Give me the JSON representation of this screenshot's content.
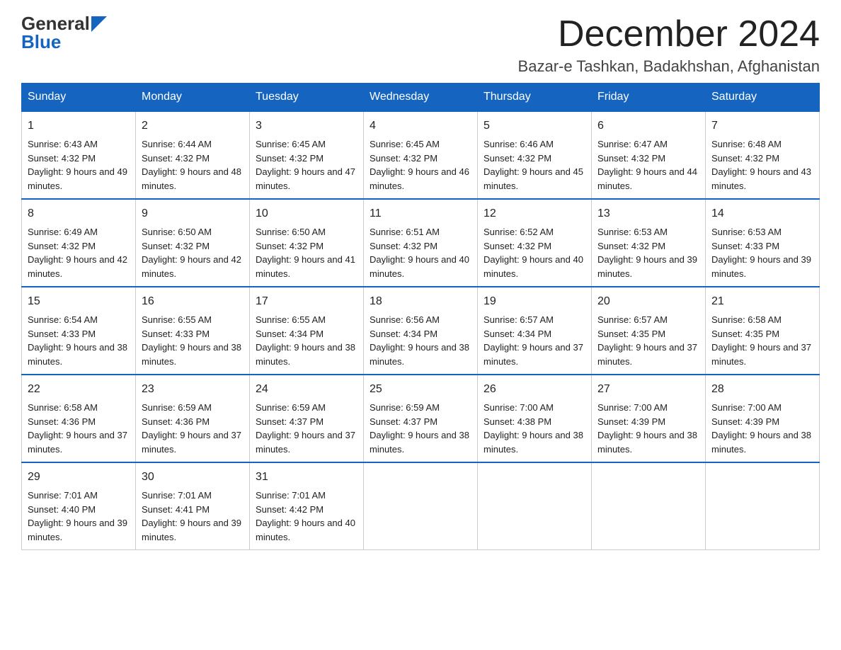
{
  "header": {
    "logo_line1": "General",
    "logo_line2": "Blue",
    "month_title": "December 2024",
    "location": "Bazar-e Tashkan, Badakhshan, Afghanistan"
  },
  "weekdays": [
    "Sunday",
    "Monday",
    "Tuesday",
    "Wednesday",
    "Thursday",
    "Friday",
    "Saturday"
  ],
  "weeks": [
    [
      {
        "day": "1",
        "sunrise": "Sunrise: 6:43 AM",
        "sunset": "Sunset: 4:32 PM",
        "daylight": "Daylight: 9 hours and 49 minutes."
      },
      {
        "day": "2",
        "sunrise": "Sunrise: 6:44 AM",
        "sunset": "Sunset: 4:32 PM",
        "daylight": "Daylight: 9 hours and 48 minutes."
      },
      {
        "day": "3",
        "sunrise": "Sunrise: 6:45 AM",
        "sunset": "Sunset: 4:32 PM",
        "daylight": "Daylight: 9 hours and 47 minutes."
      },
      {
        "day": "4",
        "sunrise": "Sunrise: 6:45 AM",
        "sunset": "Sunset: 4:32 PM",
        "daylight": "Daylight: 9 hours and 46 minutes."
      },
      {
        "day": "5",
        "sunrise": "Sunrise: 6:46 AM",
        "sunset": "Sunset: 4:32 PM",
        "daylight": "Daylight: 9 hours and 45 minutes."
      },
      {
        "day": "6",
        "sunrise": "Sunrise: 6:47 AM",
        "sunset": "Sunset: 4:32 PM",
        "daylight": "Daylight: 9 hours and 44 minutes."
      },
      {
        "day": "7",
        "sunrise": "Sunrise: 6:48 AM",
        "sunset": "Sunset: 4:32 PM",
        "daylight": "Daylight: 9 hours and 43 minutes."
      }
    ],
    [
      {
        "day": "8",
        "sunrise": "Sunrise: 6:49 AM",
        "sunset": "Sunset: 4:32 PM",
        "daylight": "Daylight: 9 hours and 42 minutes."
      },
      {
        "day": "9",
        "sunrise": "Sunrise: 6:50 AM",
        "sunset": "Sunset: 4:32 PM",
        "daylight": "Daylight: 9 hours and 42 minutes."
      },
      {
        "day": "10",
        "sunrise": "Sunrise: 6:50 AM",
        "sunset": "Sunset: 4:32 PM",
        "daylight": "Daylight: 9 hours and 41 minutes."
      },
      {
        "day": "11",
        "sunrise": "Sunrise: 6:51 AM",
        "sunset": "Sunset: 4:32 PM",
        "daylight": "Daylight: 9 hours and 40 minutes."
      },
      {
        "day": "12",
        "sunrise": "Sunrise: 6:52 AM",
        "sunset": "Sunset: 4:32 PM",
        "daylight": "Daylight: 9 hours and 40 minutes."
      },
      {
        "day": "13",
        "sunrise": "Sunrise: 6:53 AM",
        "sunset": "Sunset: 4:32 PM",
        "daylight": "Daylight: 9 hours and 39 minutes."
      },
      {
        "day": "14",
        "sunrise": "Sunrise: 6:53 AM",
        "sunset": "Sunset: 4:33 PM",
        "daylight": "Daylight: 9 hours and 39 minutes."
      }
    ],
    [
      {
        "day": "15",
        "sunrise": "Sunrise: 6:54 AM",
        "sunset": "Sunset: 4:33 PM",
        "daylight": "Daylight: 9 hours and 38 minutes."
      },
      {
        "day": "16",
        "sunrise": "Sunrise: 6:55 AM",
        "sunset": "Sunset: 4:33 PM",
        "daylight": "Daylight: 9 hours and 38 minutes."
      },
      {
        "day": "17",
        "sunrise": "Sunrise: 6:55 AM",
        "sunset": "Sunset: 4:34 PM",
        "daylight": "Daylight: 9 hours and 38 minutes."
      },
      {
        "day": "18",
        "sunrise": "Sunrise: 6:56 AM",
        "sunset": "Sunset: 4:34 PM",
        "daylight": "Daylight: 9 hours and 38 minutes."
      },
      {
        "day": "19",
        "sunrise": "Sunrise: 6:57 AM",
        "sunset": "Sunset: 4:34 PM",
        "daylight": "Daylight: 9 hours and 37 minutes."
      },
      {
        "day": "20",
        "sunrise": "Sunrise: 6:57 AM",
        "sunset": "Sunset: 4:35 PM",
        "daylight": "Daylight: 9 hours and 37 minutes."
      },
      {
        "day": "21",
        "sunrise": "Sunrise: 6:58 AM",
        "sunset": "Sunset: 4:35 PM",
        "daylight": "Daylight: 9 hours and 37 minutes."
      }
    ],
    [
      {
        "day": "22",
        "sunrise": "Sunrise: 6:58 AM",
        "sunset": "Sunset: 4:36 PM",
        "daylight": "Daylight: 9 hours and 37 minutes."
      },
      {
        "day": "23",
        "sunrise": "Sunrise: 6:59 AM",
        "sunset": "Sunset: 4:36 PM",
        "daylight": "Daylight: 9 hours and 37 minutes."
      },
      {
        "day": "24",
        "sunrise": "Sunrise: 6:59 AM",
        "sunset": "Sunset: 4:37 PM",
        "daylight": "Daylight: 9 hours and 37 minutes."
      },
      {
        "day": "25",
        "sunrise": "Sunrise: 6:59 AM",
        "sunset": "Sunset: 4:37 PM",
        "daylight": "Daylight: 9 hours and 38 minutes."
      },
      {
        "day": "26",
        "sunrise": "Sunrise: 7:00 AM",
        "sunset": "Sunset: 4:38 PM",
        "daylight": "Daylight: 9 hours and 38 minutes."
      },
      {
        "day": "27",
        "sunrise": "Sunrise: 7:00 AM",
        "sunset": "Sunset: 4:39 PM",
        "daylight": "Daylight: 9 hours and 38 minutes."
      },
      {
        "day": "28",
        "sunrise": "Sunrise: 7:00 AM",
        "sunset": "Sunset: 4:39 PM",
        "daylight": "Daylight: 9 hours and 38 minutes."
      }
    ],
    [
      {
        "day": "29",
        "sunrise": "Sunrise: 7:01 AM",
        "sunset": "Sunset: 4:40 PM",
        "daylight": "Daylight: 9 hours and 39 minutes."
      },
      {
        "day": "30",
        "sunrise": "Sunrise: 7:01 AM",
        "sunset": "Sunset: 4:41 PM",
        "daylight": "Daylight: 9 hours and 39 minutes."
      },
      {
        "day": "31",
        "sunrise": "Sunrise: 7:01 AM",
        "sunset": "Sunset: 4:42 PM",
        "daylight": "Daylight: 9 hours and 40 minutes."
      },
      null,
      null,
      null,
      null
    ]
  ]
}
